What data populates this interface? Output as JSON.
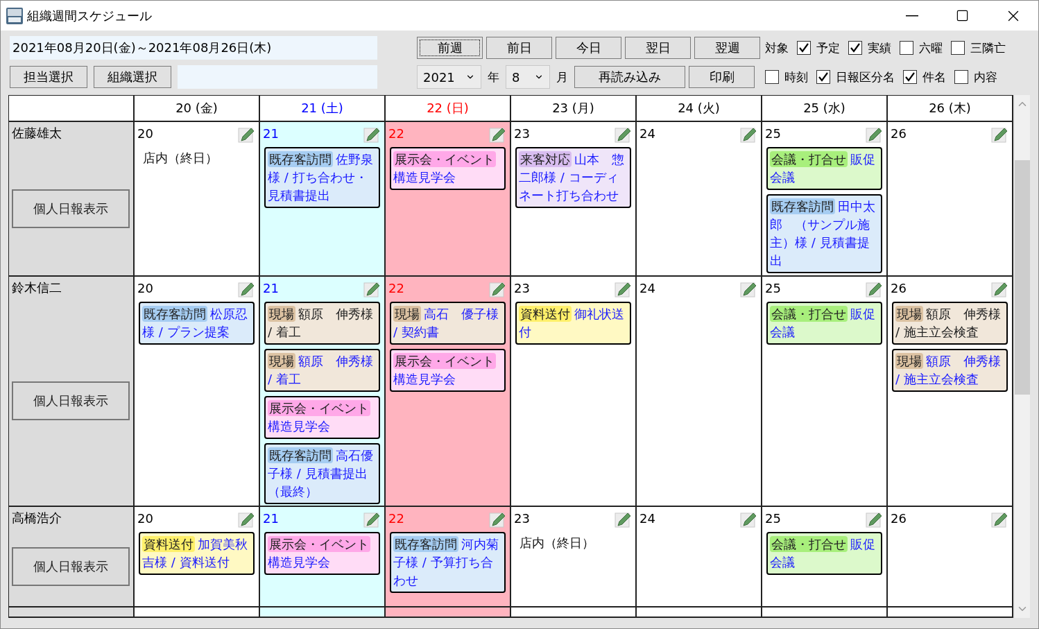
{
  "window": {
    "title": "組織週間スケジュール"
  },
  "toolbar": {
    "date_range": "2021年08月20日(金)～2021年08月26日(木)",
    "nav_buttons": [
      {
        "label": "前週",
        "focused": true
      },
      {
        "label": "前日",
        "focused": false
      },
      {
        "label": "今日",
        "focused": false
      },
      {
        "label": "翌日",
        "focused": false
      },
      {
        "label": "翌週",
        "focused": false
      }
    ],
    "target_label": "対象",
    "filters_top": [
      {
        "label": "予定",
        "checked": true
      },
      {
        "label": "実績",
        "checked": true
      },
      {
        "label": "六曜",
        "checked": false
      },
      {
        "label": "三隣亡",
        "checked": false
      }
    ],
    "staff_button": "担当選択",
    "org_button": "組織選択",
    "year": "2021",
    "year_suffix": "年",
    "month": "8",
    "month_suffix": "月",
    "reload_button": "再読み込み",
    "print_button": "印刷",
    "filters_bottom": [
      {
        "label": "時刻",
        "checked": false
      },
      {
        "label": "日報区分名",
        "checked": true
      },
      {
        "label": "件名",
        "checked": true
      },
      {
        "label": "内容",
        "checked": false
      }
    ]
  },
  "calendar": {
    "days": [
      {
        "label": "20 (金)",
        "kind": "weekday"
      },
      {
        "label": "21 (土)",
        "kind": "saturday"
      },
      {
        "label": "22 (日)",
        "kind": "sunday"
      },
      {
        "label": "23 (月)",
        "kind": "weekday"
      },
      {
        "label": "24 (火)",
        "kind": "weekday"
      },
      {
        "label": "25 (水)",
        "kind": "weekday"
      },
      {
        "label": "26 (木)",
        "kind": "weekday"
      }
    ],
    "rows": [
      {
        "name": "佐藤雄太",
        "button": "個人日報表示",
        "cells": [
          {
            "day": "20",
            "items": [
              {
                "kind": "note",
                "text": "店内（終日）"
              }
            ]
          },
          {
            "day": "21",
            "items": [
              {
                "kind": "event",
                "category": "既存客訪問",
                "color": "#a6cdf2",
                "title": "佐野泉様 / 打ち合わせ・見積書提出",
                "linked": true
              }
            ]
          },
          {
            "day": "22",
            "items": [
              {
                "kind": "event",
                "category": "展示会・イベント",
                "color": "#ffa8e8",
                "title": "構造見学会",
                "linked": true
              }
            ]
          },
          {
            "day": "23",
            "items": [
              {
                "kind": "event",
                "category": "来客対応",
                "color": "#d8bdf0",
                "title": "山本　惣二郎様 / コーディネート打ち合わせ",
                "linked": true
              }
            ]
          },
          {
            "day": "24"
          },
          {
            "day": "25",
            "items": [
              {
                "kind": "event",
                "category": "会議・打合せ",
                "color": "#a8ef7c",
                "title": "販促会議",
                "linked": true
              },
              {
                "kind": "event",
                "category": "既存客訪問",
                "color": "#a6cdf2",
                "title": "田中太郎　（サンプル施主）様 / 見積書提出",
                "linked": true
              }
            ]
          },
          {
            "day": "26"
          }
        ]
      },
      {
        "name": "鈴木信二",
        "button": "個人日報表示",
        "cells": [
          {
            "day": "20",
            "items": [
              {
                "kind": "event",
                "category": "既存客訪問",
                "color": "#a6cdf2",
                "title": "松原忍様 / プラン提案",
                "linked": true
              }
            ]
          },
          {
            "day": "21",
            "items": [
              {
                "kind": "event",
                "category": "現場",
                "color": "#dcc2a2",
                "title": "額原　伸秀様 / 着工",
                "linked": false
              },
              {
                "kind": "event",
                "category": "現場",
                "color": "#dcc2a2",
                "title": "額原　伸秀様 / 着工",
                "linked": true
              },
              {
                "kind": "event",
                "category": "展示会・イベント",
                "color": "#ffa8e8",
                "title": "構造見学会",
                "linked": true
              },
              {
                "kind": "event",
                "category": "既存客訪問",
                "color": "#a6cdf2",
                "title": "高石優子様 / 見積書提出（最終）",
                "linked": true
              }
            ]
          },
          {
            "day": "22",
            "items": [
              {
                "kind": "event",
                "category": "現場",
                "color": "#dcc2a2",
                "title": "高石　優子様 / 契約書",
                "linked": true
              },
              {
                "kind": "event",
                "category": "展示会・イベント",
                "color": "#ffa8e8",
                "title": "構造見学会",
                "linked": true
              }
            ]
          },
          {
            "day": "23",
            "items": [
              {
                "kind": "event",
                "category": "資料送付",
                "color": "#fff06a",
                "title": "御礼状送付",
                "linked": true
              }
            ]
          },
          {
            "day": "24"
          },
          {
            "day": "25",
            "items": [
              {
                "kind": "event",
                "category": "会議・打合せ",
                "color": "#a8ef7c",
                "title": "販促会議",
                "linked": true
              }
            ]
          },
          {
            "day": "26",
            "items": [
              {
                "kind": "event",
                "category": "現場",
                "color": "#dcc2a2",
                "title": "額原　伸秀様 / 施主立会検査",
                "linked": false
              },
              {
                "kind": "event",
                "category": "現場",
                "color": "#dcc2a2",
                "title": "額原　伸秀様 / 施主立会検査",
                "linked": true
              }
            ]
          }
        ]
      },
      {
        "name": "高橋浩介",
        "button": "個人日報表示",
        "cells": [
          {
            "day": "20",
            "items": [
              {
                "kind": "event",
                "category": "資料送付",
                "color": "#fff06a",
                "title": "加賀美秋吉様 / 資料送付",
                "linked": true
              }
            ]
          },
          {
            "day": "21",
            "items": [
              {
                "kind": "event",
                "category": "展示会・イベント",
                "color": "#ffa8e8",
                "title": "構造見学会",
                "linked": true
              }
            ]
          },
          {
            "day": "22",
            "items": [
              {
                "kind": "event",
                "category": "既存客訪問",
                "color": "#a6cdf2",
                "title": "河内菊子様 / 予算打ち合わせ",
                "linked": true
              }
            ]
          },
          {
            "day": "23",
            "items": [
              {
                "kind": "note",
                "text": "店内（終日）"
              }
            ]
          },
          {
            "day": "24"
          },
          {
            "day": "25",
            "items": [
              {
                "kind": "event",
                "category": "会議・打合せ",
                "color": "#a8ef7c",
                "title": "販促会議",
                "linked": true
              }
            ]
          },
          {
            "day": "26"
          }
        ]
      }
    ]
  }
}
